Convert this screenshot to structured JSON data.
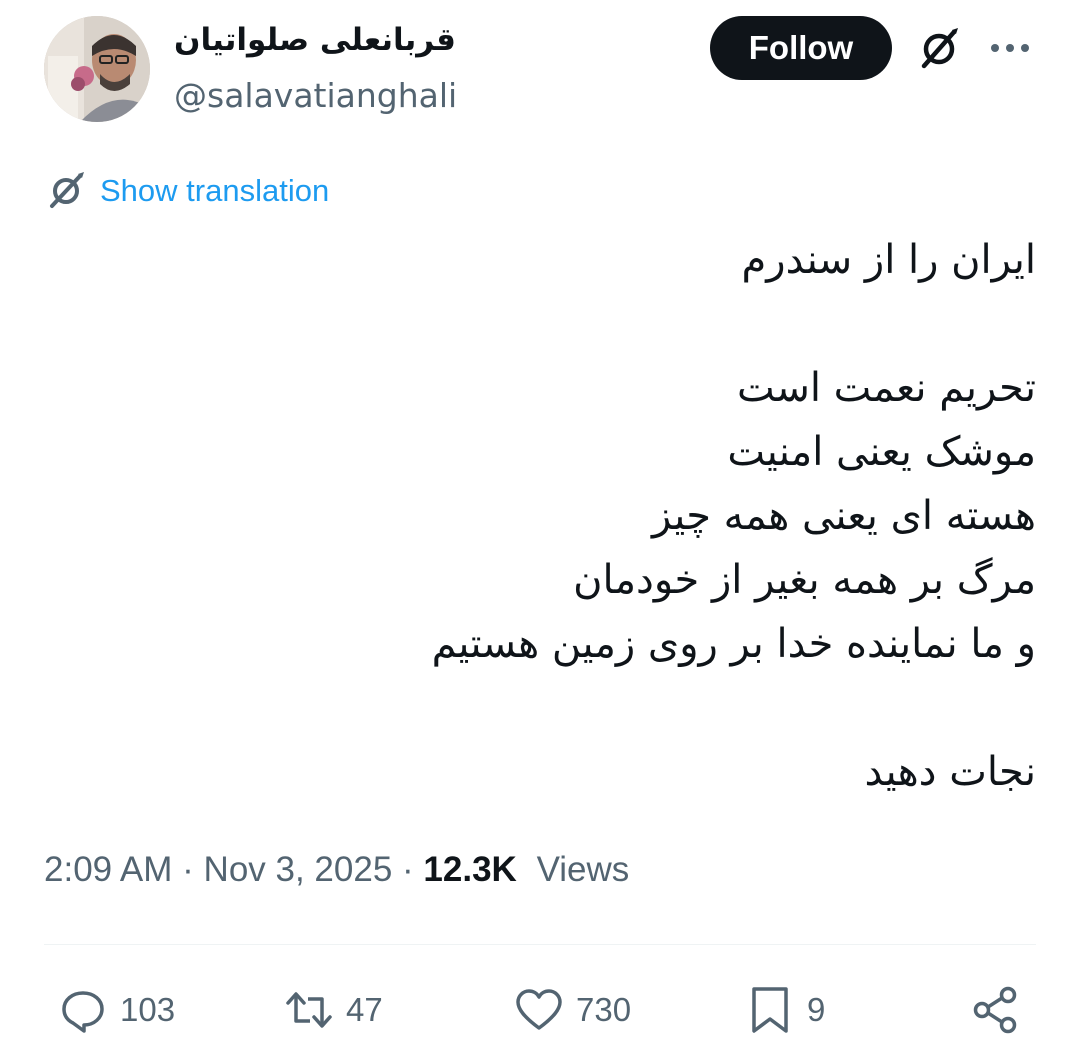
{
  "author": {
    "display_name": "قربانعلی صلواتیان",
    "handle": "@salavatianghali"
  },
  "header": {
    "follow_label": "Follow",
    "grok_icon": "grok-icon",
    "more_icon": "more-horizontal-icon"
  },
  "translation": {
    "label": "Show translation",
    "icon": "translate-icon"
  },
  "tweet": {
    "lines": [
      "ایران را از سندرم",
      "",
      "تحریم نعمت است",
      "موشک یعنی امنیت",
      "هسته ای یعنی همه چیز",
      "مرگ بر همه بغیر از خودمان",
      "و ما نماینده خدا بر روی زمین هستیم",
      "",
      "نجات دهید"
    ]
  },
  "meta": {
    "time": "2:09 AM",
    "date": "Nov 3, 2025",
    "views_count": "12.3K",
    "views_label": "Views"
  },
  "actions": {
    "replies": "103",
    "reposts": "47",
    "likes": "730",
    "bookmarks": "9"
  },
  "colors": {
    "link": "#1d9bf0",
    "secondary_text": "#536471",
    "primary_text": "#0f1419",
    "follow_bg": "#0f1419"
  }
}
